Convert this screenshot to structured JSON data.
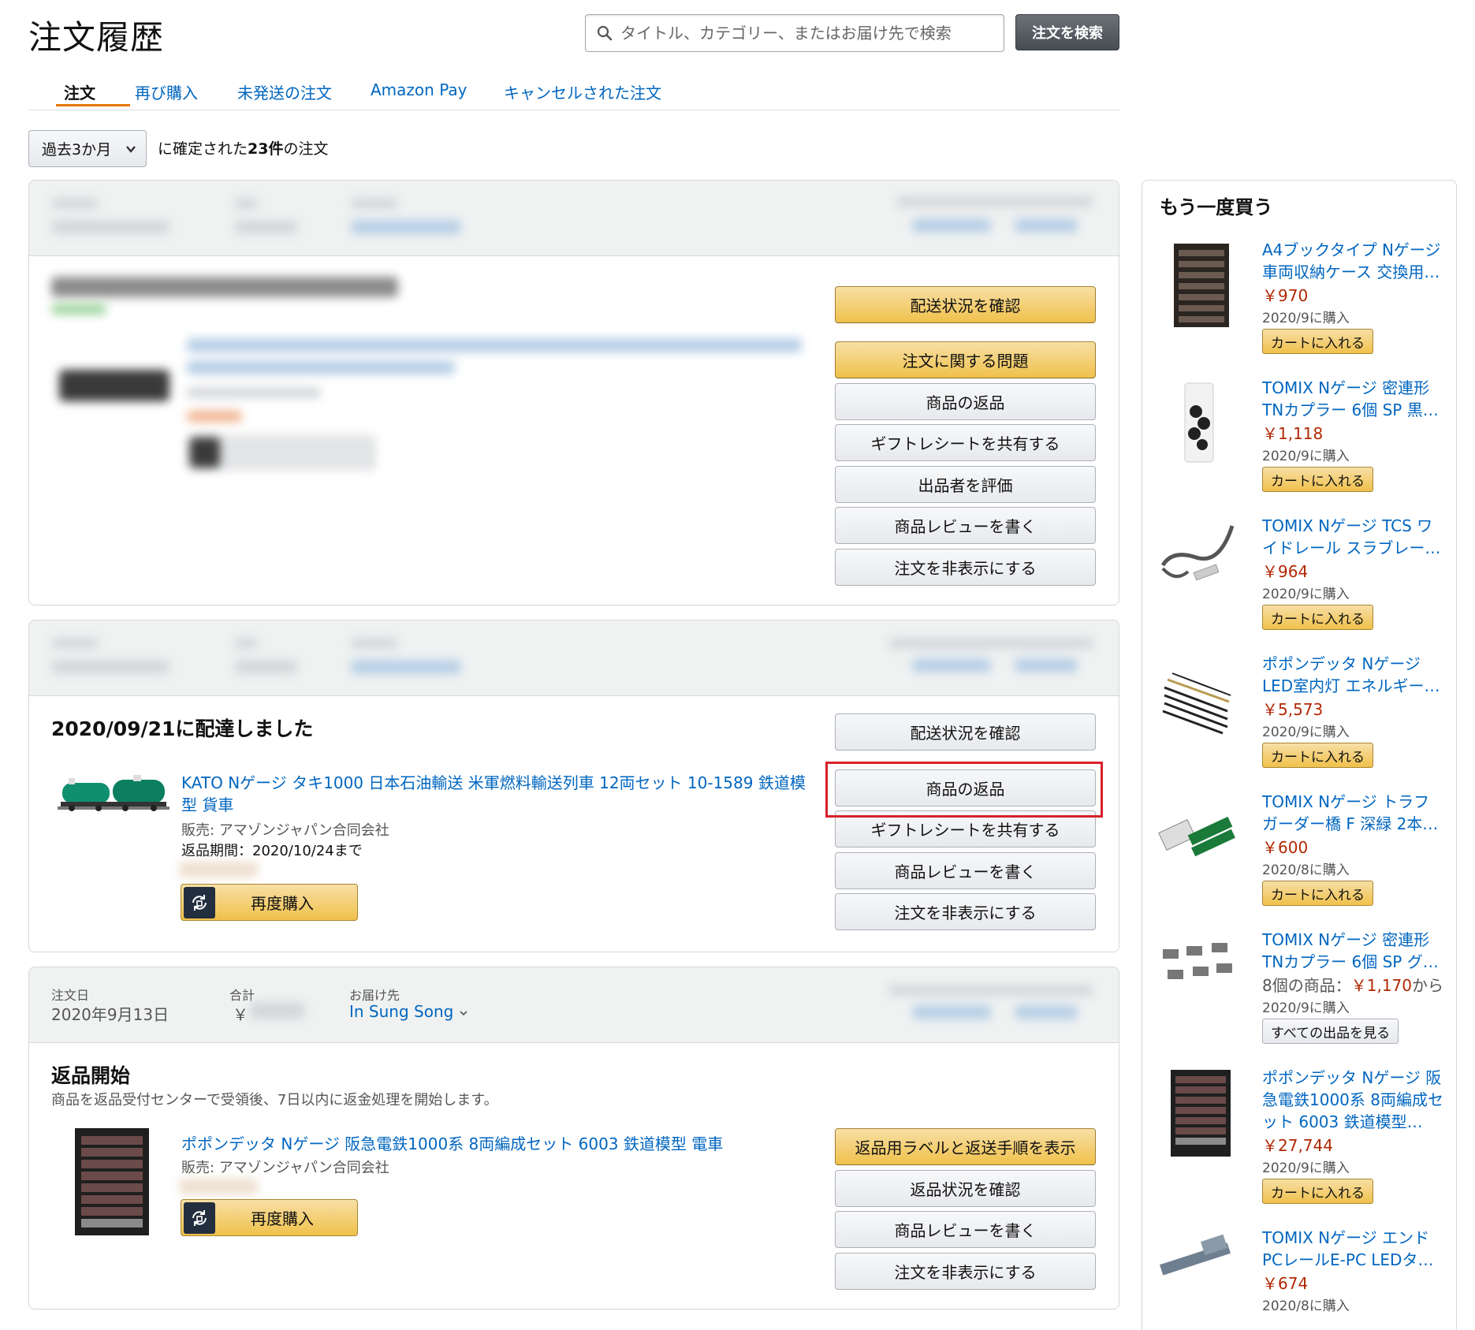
{
  "header": {
    "title": "注文履歴",
    "search_placeholder": "タイトル、カテゴリー、またはお届け先で検索",
    "search_button": "注文を検索"
  },
  "tabs": [
    {
      "label": "注文",
      "active": true
    },
    {
      "label": "再び購入",
      "active": false
    },
    {
      "label": "未発送の注文",
      "active": false
    },
    {
      "label": "Amazon Pay",
      "active": false
    },
    {
      "label": "キャンセルされた注文",
      "active": false
    }
  ],
  "filter": {
    "selected": "過去3か月",
    "text_prefix": "に確定された",
    "count": "23件",
    "text_suffix": "の注文"
  },
  "orders": [
    {
      "buttons": [
        "配送状況を確認",
        "注文に関する問題",
        "商品の返品",
        "ギフトレシートを共有する",
        "出品者を評価",
        "商品レビューを書く",
        "注文を非表示にする"
      ]
    },
    {
      "status": "2020/09/21に配達しました",
      "product_title": "KATO Nゲージ タキ1000 日本石油輸送 米軍燃料輸送列車 12両セット 10-1589 鉄道模型 貨車",
      "seller": "販売: アマゾンジャパン合同会社",
      "return_period": "返品期間：2020/10/24まで",
      "rebuy": "再度購入",
      "buttons": [
        "配送状況を確認",
        "商品の返品",
        "ギフトレシートを共有する",
        "商品レビューを書く",
        "注文を非表示にする"
      ]
    },
    {
      "order_date_label": "注文日",
      "order_date": "2020年9月13日",
      "total_label": "合計",
      "total_currency": "￥",
      "ship_to_label": "お届け先",
      "ship_to": "In Sung Song",
      "status": "返品開始",
      "status_note": "商品を返品受付センターで受領後、7日以内に返金処理を開始します。",
      "product_title": "ポポンデッタ Nゲージ 阪急電鉄1000系 8両編成セット 6003 鉄道模型 電車",
      "seller": "販売: アマゾンジャパン合同会社",
      "rebuy": "再度購入",
      "buttons": [
        "返品用ラベルと返送手順を表示",
        "返品状況を確認",
        "商品レビューを書く",
        "注文を非表示にする"
      ]
    }
  ],
  "sidebar": {
    "title": "もう一度買う",
    "items": [
      {
        "line1": "A4ブックタイプ Nゲージ",
        "line2": "車両収納ケース 交換用…",
        "price": "￥970",
        "date": "2020/9に購入",
        "action": "カートに入れる"
      },
      {
        "line1": "TOMIX Nゲージ 密連形",
        "line2": "TNカプラー 6個 SP 黒…",
        "price": "￥1,118",
        "date": "2020/9に購入",
        "action": "カートに入れる"
      },
      {
        "line1": "TOMIX Nゲージ TCS ワ",
        "line2": "イドレール スラブレー…",
        "price": "￥964",
        "date": "2020/9に購入",
        "action": "カートに入れる"
      },
      {
        "line1": "ポポンデッタ Nゲージ",
        "line2": "LED室内灯 エネルギー…",
        "price": "￥5,573",
        "date": "2020/9に購入",
        "action": "カートに入れる"
      },
      {
        "line1": "TOMIX Nゲージ トラフ",
        "line2": "ガーダー橋 F 深緑 2本…",
        "price": "￥600",
        "date": "2020/8に購入",
        "action": "カートに入れる"
      },
      {
        "line1": "TOMIX Nゲージ 密連形",
        "line2": "TNカプラー 6個 SP グ…",
        "price_prefix": "8個の商品：",
        "price": "￥1,170",
        "price_suffix": "から",
        "date": "2020/9に購入",
        "action": "すべての出品を見る"
      },
      {
        "line1": "ポポンデッタ Nゲージ 阪",
        "line2": "急電鉄1000系 8両編成セ",
        "line3": "ット 6003 鉄道模型…",
        "price": "￥27,744",
        "date": "2020/9に購入",
        "action": "カートに入れる"
      },
      {
        "line1": "TOMIX Nゲージ エンド",
        "line2": "PCレールE-PC LEDタ…",
        "price": "￥674",
        "date": "2020/8に購入"
      }
    ]
  },
  "colors": {
    "link": "#0066c0",
    "price": "#b12704",
    "highlight": "#d9202a",
    "tab_underline": "#e77600"
  }
}
